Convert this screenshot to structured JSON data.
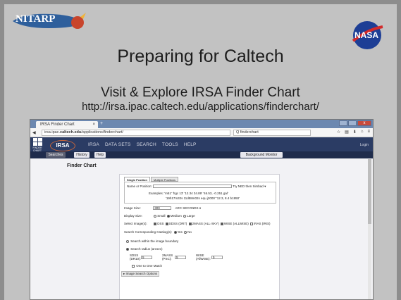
{
  "slide": {
    "title": "Preparing for Caltech",
    "subtitle": "Visit & Explore IRSA Finder Chart",
    "url": "http://irsa.ipac.caltech.edu/applications/finderchart/",
    "logo_left": "NITARP",
    "logo_right": "NASA"
  },
  "browser": {
    "tab_label": "IRSA Finder Chart",
    "tab_close": "×",
    "tab_new": "+",
    "url_prefix": "irsa.ipac.",
    "url_domain": "caltech.edu",
    "url_path": "/applications/finderchart/",
    "search_placeholder": "Q  finderchart",
    "close_glyph": "x"
  },
  "irsa": {
    "logo": "IRSA",
    "menu": [
      "IRSA",
      "DATA SETS",
      "SEARCH",
      "TOOLS",
      "HELP"
    ],
    "login": "Login",
    "fc_label": "FINDER CHART",
    "subnav": [
      "Searches",
      "History",
      "Help"
    ],
    "background_monitor": "Background Monitor"
  },
  "form": {
    "page_title": "Finder Chart",
    "tabs": [
      "Single Position",
      "Multiple Positions"
    ],
    "name_label": "Name or Position:",
    "ned_label": "Try NED then Simbad",
    "examples_label": "Examples:",
    "examples_1": "'m51'   'hgc 13'   '12.34 34.89'   '46.53, -0.251 gal'",
    "examples_2": "'19h17m32s 11d58m02s equ j2000'   '12.3, 8.4 b1950'",
    "image_size_label": "Image Size:",
    "image_size_value": "300",
    "image_size_unit": "ARC SECONDS",
    "display_size_label": "Display Size:",
    "display_small": "Small",
    "display_medium": "Medium",
    "display_large": "Large",
    "select_images_label": "Select Image(s):",
    "images": [
      "DSS",
      "SDSS (DR7)",
      "2MASS (ALL-SKY)",
      "WISE (ALLWISE)",
      "IRAS (IRIS)"
    ],
    "search_catalog_label": "Search Corresponding Catalog(s):",
    "yes": "Yes",
    "no": "No",
    "search_within": "Search within the image boundary",
    "search_radius": "Search radius (arcsec)",
    "sdss_label": "SDSS (DR10):",
    "sdss_value": "5",
    "twomass_label": "2MASS (PSC):",
    "twomass_value": "5",
    "wise_label": "WISE (AllWISE):",
    "wise_value": "5",
    "one_to_one": "One to One Match",
    "image_search_options": "Image Search Options"
  },
  "colors": {
    "slide_bg": "#c2c2c2",
    "tabbar": "#6c88b0",
    "irsa_header": "#2b3c64"
  }
}
